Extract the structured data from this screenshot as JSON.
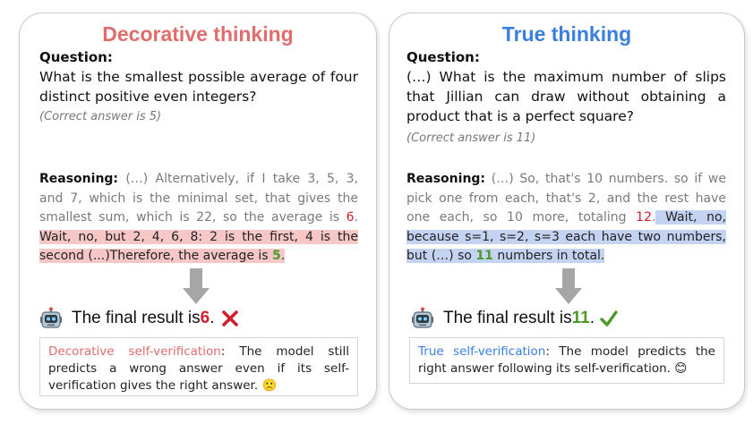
{
  "colors": {
    "decorative_title": "#e06c6c",
    "true_title": "#3a7fe0",
    "wrong_number": "#d01f2a",
    "right_number": "#4c9a2a",
    "highlight_red": "#f7c7c7",
    "highlight_blue": "#c5d3f2"
  },
  "left": {
    "title": "Decorative thinking",
    "question_label": "Question:",
    "question_text": "What is the smallest possible average of four distinct positive even integers?",
    "correct_note": "(Correct answer is 5)",
    "reasoning_label": "Reasoning:",
    "reasoning_plain": " (…) Alternatively, if I take 3, 5, 3, and 7, which is the minimal set, that gives the smallest sum, which is 22, so the average is ",
    "reasoning_wrong_num": "6",
    "reasoning_after_num": ".",
    "reasoning_highlight": " Wait, no, but 2, 4, 6, 8: 2 is the first, 4 is the second (...)Therefore, the average is ",
    "reasoning_right_num": "5",
    "reasoning_end": ".",
    "final_prefix": "The final result is ",
    "final_value": "6",
    "final_suffix": ".",
    "final_mark": "cross-mark-icon",
    "verif_label": "Decorative self-verification",
    "verif_text": ": The model still predicts a wrong answer even if its self-verification gives the right answer. ",
    "verif_emoji": "🙁"
  },
  "right": {
    "title": "True thinking",
    "question_label": "Question:",
    "question_text": "(…) What is the maximum number of slips that Jillian can draw without obtaining a product that is a perfect square?",
    "correct_note": "(Correct answer is 11)",
    "reasoning_label": "Reasoning:",
    "reasoning_plain": " (…) So, that's 10 numbers. so if we pick one from each, that's 2, and the rest have one each, so 10 more, totaling ",
    "reasoning_wrong_num": "12",
    "reasoning_after_num": ".",
    "reasoning_highlight": " Wait, no, because s=1, s=2, s=3 each have two numbers, but (…) so ",
    "reasoning_right_num": "11",
    "reasoning_highlight_end": " numbers in total.",
    "final_prefix": "The final result is ",
    "final_value": "11",
    "final_suffix": ".",
    "final_mark": "check-mark-icon",
    "verif_label": "True self-verification",
    "verif_text": ": The model predicts the right answer following its self-verification. ",
    "verif_emoji": "😊"
  }
}
